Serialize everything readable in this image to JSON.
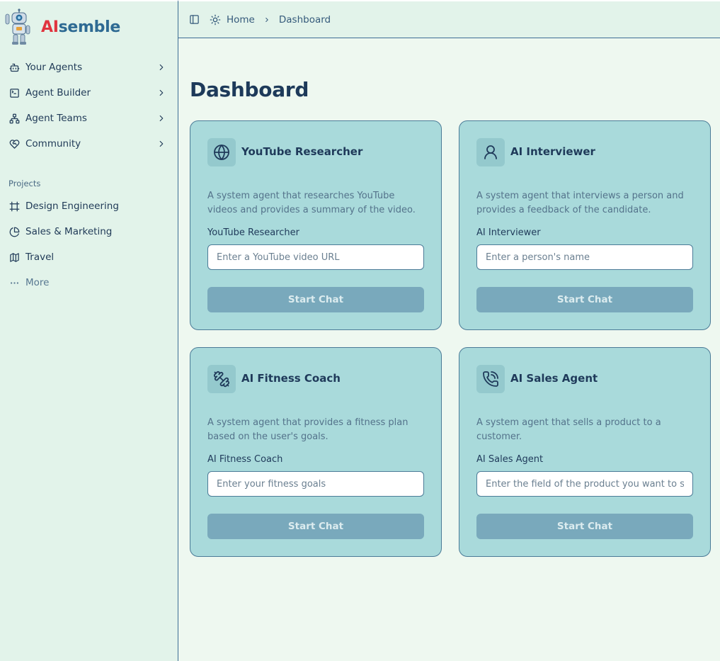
{
  "brand": {
    "name_accent": "AI",
    "name_rest": "semble"
  },
  "sidebar": {
    "items": [
      {
        "label": "Your Agents",
        "icon": "bot-icon"
      },
      {
        "label": "Agent Builder",
        "icon": "terminal-square-icon"
      },
      {
        "label": "Agent Teams",
        "icon": "network-icon"
      },
      {
        "label": "Community",
        "icon": "heart-handshake-icon"
      }
    ],
    "projects_label": "Projects",
    "projects": [
      {
        "label": "Design Engineering",
        "icon": "hash-frame-icon"
      },
      {
        "label": "Sales & Marketing",
        "icon": "pie-chart-icon"
      },
      {
        "label": "Travel",
        "icon": "map-icon"
      },
      {
        "label": "More",
        "icon": "more-horizontal-icon"
      }
    ]
  },
  "breadcrumb": {
    "home": "Home",
    "current": "Dashboard"
  },
  "page": {
    "title": "Dashboard"
  },
  "cards": [
    {
      "title": "YouTube Researcher",
      "icon": "globe-icon",
      "description": "A system agent that researches YouTube videos and provides a summary of the video.",
      "field_label": "YouTube Researcher",
      "placeholder": "Enter a YouTube video URL",
      "button": "Start Chat"
    },
    {
      "title": "AI Interviewer",
      "icon": "user-icon",
      "description": "A system agent that interviews a person and provides a feedback of the candidate.",
      "field_label": "AI Interviewer",
      "placeholder": "Enter a person's name",
      "button": "Start Chat"
    },
    {
      "title": "AI Fitness Coach",
      "icon": "dumbbell-icon",
      "description": "A system agent that provides a fitness plan based on the user's goals.",
      "field_label": "AI Fitness Coach",
      "placeholder": "Enter your fitness goals",
      "button": "Start Chat"
    },
    {
      "title": "AI Sales Agent",
      "icon": "phone-call-icon",
      "description": "A system agent that sells a product to a customer.",
      "field_label": "AI Sales Agent",
      "placeholder": "Enter the field of the product you want to sell",
      "button": "Start Chat"
    }
  ],
  "colors": {
    "brand_red": "#e0343f",
    "brand_blue": "#2e6a93",
    "card_bg": "#a9dadb",
    "button_bg": "#79a9bc",
    "sidebar_bg": "#e2f3ea",
    "page_bg": "#eef8f0"
  }
}
